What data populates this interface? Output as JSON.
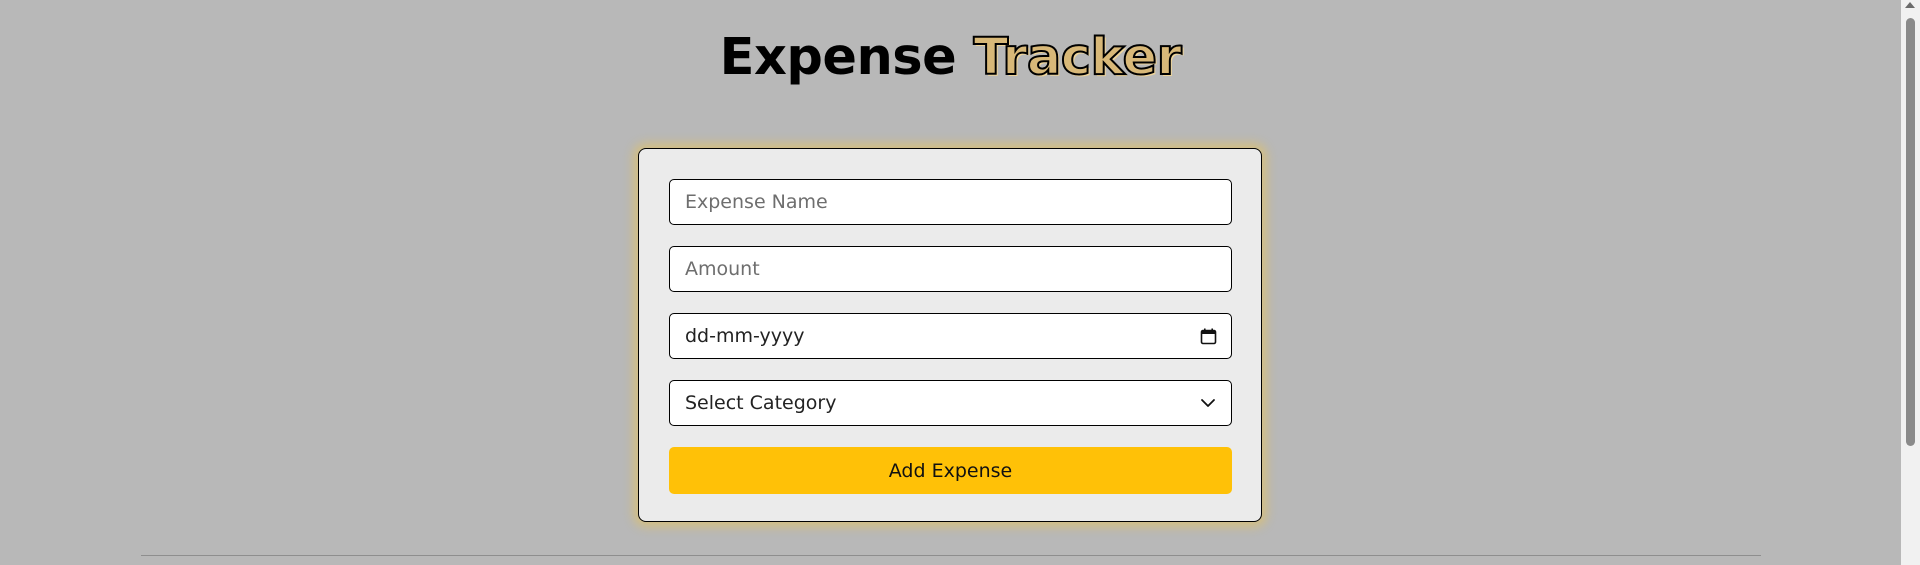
{
  "header": {
    "title_main": "Expense",
    "title_accent": "Tracker"
  },
  "form": {
    "name_placeholder": "Expense Name",
    "amount_placeholder": "Amount",
    "date_placeholder": "dd-mm-yyyy",
    "category_selected": "Select Category",
    "submit_label": "Add Expense"
  },
  "icons": {
    "date": "calendar-icon",
    "select": "chevron-down-icon"
  },
  "colors": {
    "accent": "#ffc107",
    "background": "#b8b8b8",
    "card": "#ebebeb"
  }
}
